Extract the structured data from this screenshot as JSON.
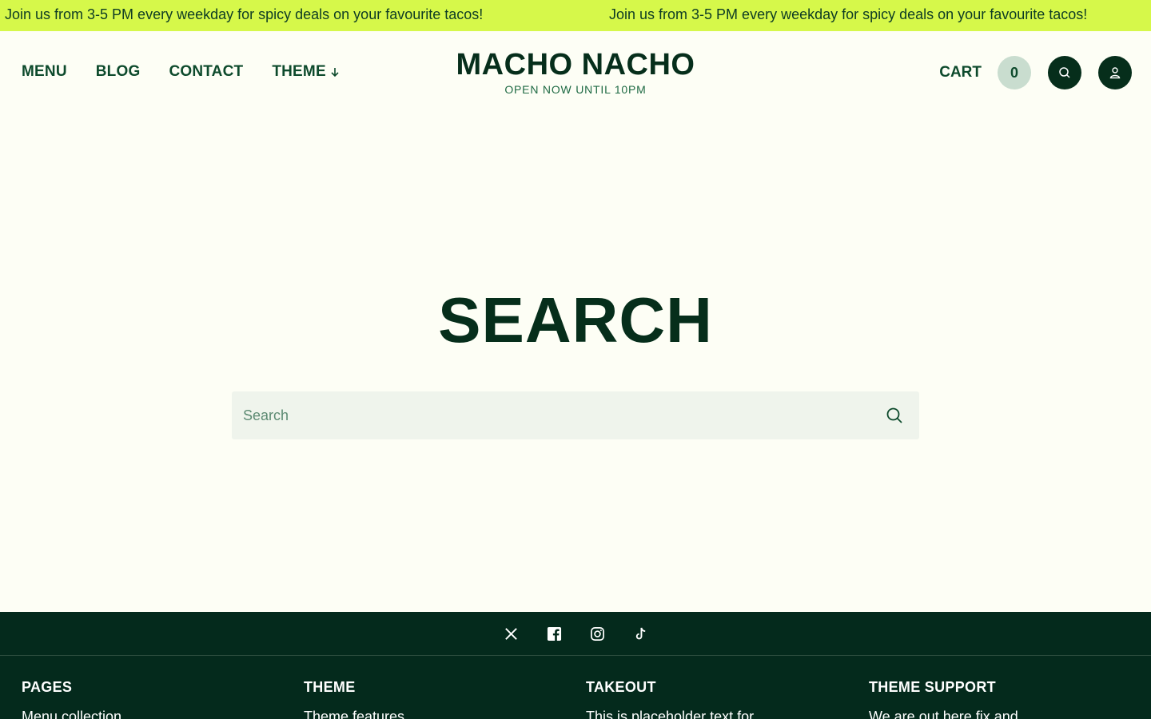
{
  "announcement": {
    "messages": [
      "Join us from 3-5 PM every weekday for spicy deals on your favourite tacos!",
      "Join us from 3-5 PM every weekday for spicy deals on your favourite tacos!"
    ]
  },
  "header": {
    "nav": [
      "MENU",
      "BLOG",
      "CONTACT",
      "THEME"
    ],
    "logo": "MACHO NACHO",
    "tagline": "OPEN NOW UNTIL 10PM",
    "cart_label": "CART",
    "cart_count": "0"
  },
  "main": {
    "title": "SEARCH",
    "search_placeholder": "Search"
  },
  "footer": {
    "social": [
      "x-icon",
      "facebook-icon",
      "instagram-icon",
      "tiktok-icon"
    ],
    "columns": [
      {
        "heading": "PAGES",
        "first_item": "Menu collection"
      },
      {
        "heading": "THEME",
        "first_item": "Theme features"
      },
      {
        "heading": "TAKEOUT",
        "first_item": "This is placeholder text for"
      },
      {
        "heading": "THEME SUPPORT",
        "first_item": "We are out here fix and"
      }
    ]
  },
  "colors": {
    "announcement_bg": "#d6f84a",
    "page_bg": "#fdfef5",
    "brand_dark": "#062e1b",
    "footer_bg": "#042a1c"
  }
}
